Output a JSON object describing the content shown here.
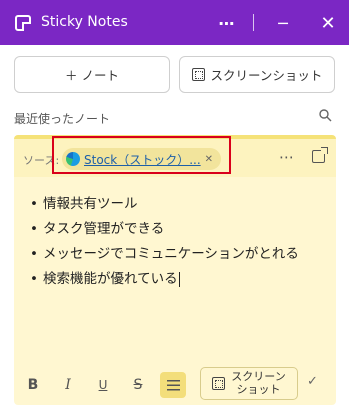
{
  "window": {
    "title": "Sticky Notes",
    "more_icon": "more-horizontal-icon",
    "minimize_icon": "minimize-icon",
    "close_icon": "close-icon"
  },
  "actions": {
    "new_note_label": "＋ ノート",
    "screenshot_label": "スクリーンショット"
  },
  "recent": {
    "label": "最近使ったノート",
    "search_icon": "search-icon"
  },
  "note": {
    "source_label": "ソース:",
    "source_link": "Stock（ストック）...",
    "source_browser_icon": "edge-icon",
    "bullets": [
      "情報共有ツール",
      "タスク管理ができる",
      "メッセージでコミュニケーションがとれる",
      "検索機能が優れている"
    ],
    "background_color": "#fff7d1",
    "accent_color": "#f5e278"
  },
  "toolbar": {
    "bold": "B",
    "italic": "I",
    "underline": "U",
    "strike": "S",
    "screenshot_line1": "スクリーン",
    "screenshot_line2": "ショット"
  },
  "colors": {
    "titlebar": "#7b27c4",
    "highlight_border": "#d9001b"
  }
}
